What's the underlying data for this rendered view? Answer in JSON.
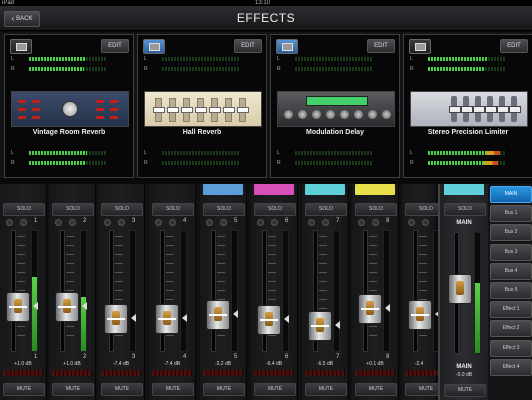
{
  "status_bar": {
    "left": "iPad",
    "time": "13:10"
  },
  "header": {
    "back_label": "BACK",
    "title": "EFFECTS"
  },
  "effects": [
    {
      "name": "Vintage Room Reverb",
      "edit_label": "EDIT",
      "icon": "effect-slot-icon",
      "icon_color": "gray",
      "in_L": 0.72,
      "in_R": 0.7,
      "out_L": 0.74,
      "out_R": 0.72
    },
    {
      "name": "Hall Reverb",
      "edit_label": "EDIT",
      "icon": "effect-slot-icon",
      "icon_color": "blue",
      "in_L": 0.0,
      "in_R": 0.0,
      "out_L": 0.0,
      "out_R": 0.0
    },
    {
      "name": "Modulation Delay",
      "edit_label": "EDIT",
      "icon": "effect-slot-icon",
      "icon_color": "blue",
      "in_L": 0.0,
      "in_R": 0.0,
      "out_L": 0.0,
      "out_R": 0.0
    },
    {
      "name": "Stereo Precision Limiter",
      "edit_label": "EDIT",
      "icon": "effect-slot-icon",
      "icon_color": "gray",
      "in_L": 0.75,
      "in_R": 0.73,
      "out_L": 0.92,
      "out_R": 0.9
    }
  ],
  "channel_labels": {
    "L": "L",
    "R": "R"
  },
  "channels": [
    {
      "number": "1",
      "color": "",
      "solo_label": "SOLO",
      "mute_label": "MUTE",
      "db": "+1.0 dB",
      "fader": 0.62,
      "meter": 0.62
    },
    {
      "number": "2",
      "color": "",
      "solo_label": "SOLO",
      "mute_label": "MUTE",
      "db": "+1.0 dB",
      "fader": 0.62,
      "meter": 0.45
    },
    {
      "number": "3",
      "color": "",
      "solo_label": "SOLO",
      "mute_label": "MUTE",
      "db": "-7.4 dB",
      "fader": 0.52,
      "meter": 0.0
    },
    {
      "number": "4",
      "color": "",
      "solo_label": "SOLO",
      "mute_label": "MUTE",
      "db": "-7.4 dB",
      "fader": 0.52,
      "meter": 0.0
    },
    {
      "number": "5",
      "color": "#5b9fd8",
      "solo_label": "SOLO",
      "mute_label": "MUTE",
      "db": "-3.2 dB",
      "fader": 0.55,
      "meter": 0.0
    },
    {
      "number": "6",
      "color": "#d84fb8",
      "solo_label": "SOLO",
      "mute_label": "MUTE",
      "db": "-6.4 dB",
      "fader": 0.51,
      "meter": 0.0
    },
    {
      "number": "7",
      "color": "#5fd0d8",
      "solo_label": "SOLO",
      "mute_label": "MUTE",
      "db": "-6.5 dB",
      "fader": 0.46,
      "meter": 0.0
    },
    {
      "number": "8",
      "color": "#e8e04a",
      "solo_label": "SOLO",
      "mute_label": "MUTE",
      "db": "+0.1 dB",
      "fader": 0.6,
      "meter": 0.0
    },
    {
      "number": "",
      "color": "",
      "solo_label": "SOLO",
      "mute_label": "MUTE",
      "db": "-2.4",
      "fader": 0.55,
      "meter": 0.0
    }
  ],
  "main": {
    "label": "MAIN",
    "solo_label": "SOLO",
    "mute_label": "MUTE",
    "db": "-0.0 dB",
    "meter": 0.58,
    "color": "#5fd0d8"
  },
  "bus_nav": [
    "MAIN",
    "Bus 1",
    "Bus 2",
    "Bus 3",
    "Bus 4",
    "Bus 5",
    "Effect 1",
    "Effect 2",
    "Effect 3",
    "Effect 4"
  ],
  "active_bus": "MAIN"
}
